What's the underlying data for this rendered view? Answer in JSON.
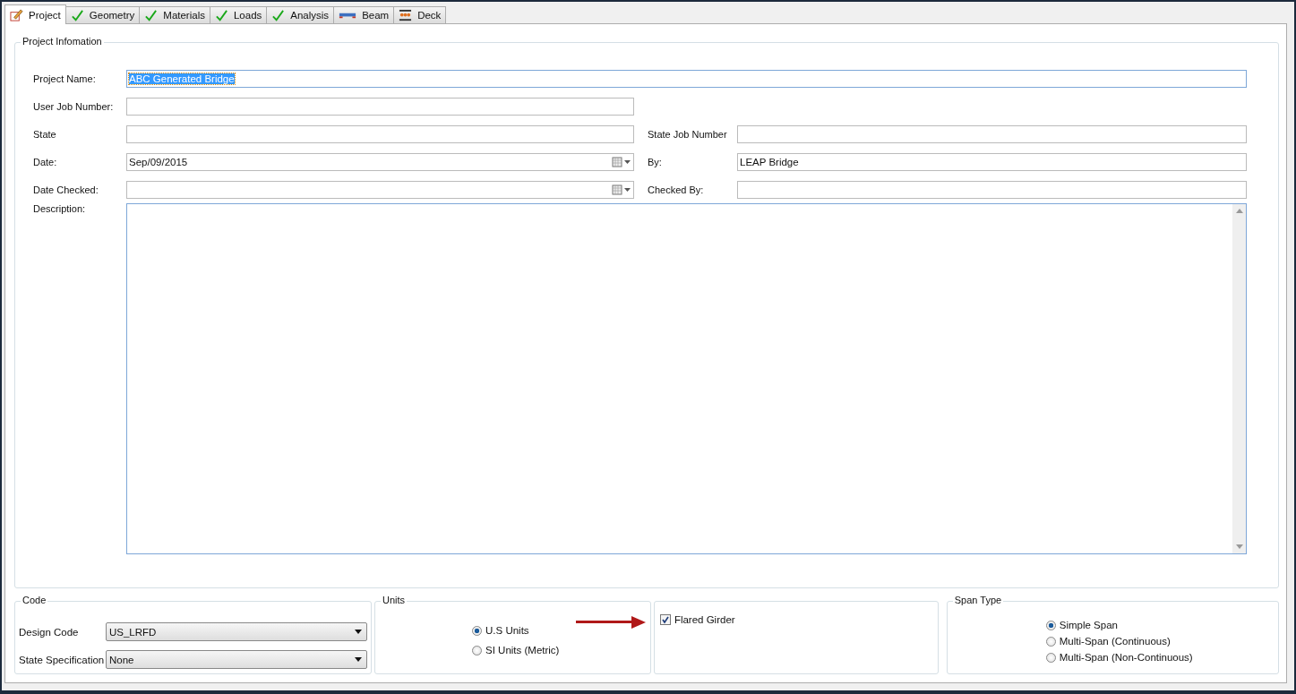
{
  "tabs": [
    {
      "label": "Project",
      "kind": "pencil",
      "selected": true
    },
    {
      "label": "Geometry",
      "kind": "check",
      "selected": false
    },
    {
      "label": "Materials",
      "kind": "check",
      "selected": false
    },
    {
      "label": "Loads",
      "kind": "check",
      "selected": false
    },
    {
      "label": "Analysis",
      "kind": "check",
      "selected": false
    },
    {
      "label": "Beam",
      "kind": "beam",
      "selected": false
    },
    {
      "label": "Deck",
      "kind": "deck",
      "selected": false
    }
  ],
  "project_information": {
    "title": "Project Infomation",
    "rows": [
      [
        {
          "label": "Project Name:",
          "kind": "full",
          "value": "ABC Generated Bridge",
          "text_selected": true
        }
      ],
      [
        {
          "label": "User Job Number:",
          "kind": "text"
        }
      ],
      [
        {
          "label": "State",
          "kind": "text"
        },
        {
          "label": "State Job Number",
          "kind": "text"
        }
      ],
      [
        {
          "label": "Date:",
          "kind": "date",
          "value": "Sep/09/2015"
        },
        {
          "label": "By:",
          "kind": "text",
          "value": "LEAP Bridge"
        }
      ],
      [
        {
          "label": "Date Checked:",
          "kind": "date"
        },
        {
          "label": "Checked By:",
          "kind": "text"
        }
      ]
    ],
    "description": {
      "label": "Description:"
    }
  },
  "code": {
    "title": "Code",
    "selects": [
      {
        "label": "Design Code",
        "value": "US_LRFD"
      },
      {
        "label": "State Specification",
        "value": "None"
      }
    ]
  },
  "units": {
    "title": "Units",
    "options": [
      {
        "label": "U.S Units",
        "selected": true
      },
      {
        "label": "SI Units (Metric)",
        "selected": false
      }
    ]
  },
  "flared_girder": {
    "label": "Flared Girder",
    "checked": true
  },
  "span_type": {
    "title": "Span Type",
    "options": [
      {
        "label": "Simple Span",
        "selected": true
      },
      {
        "label": "Multi-Span (Continuous)",
        "selected": false
      },
      {
        "label": "Multi-Span (Non-Continuous)",
        "selected": false
      }
    ]
  }
}
